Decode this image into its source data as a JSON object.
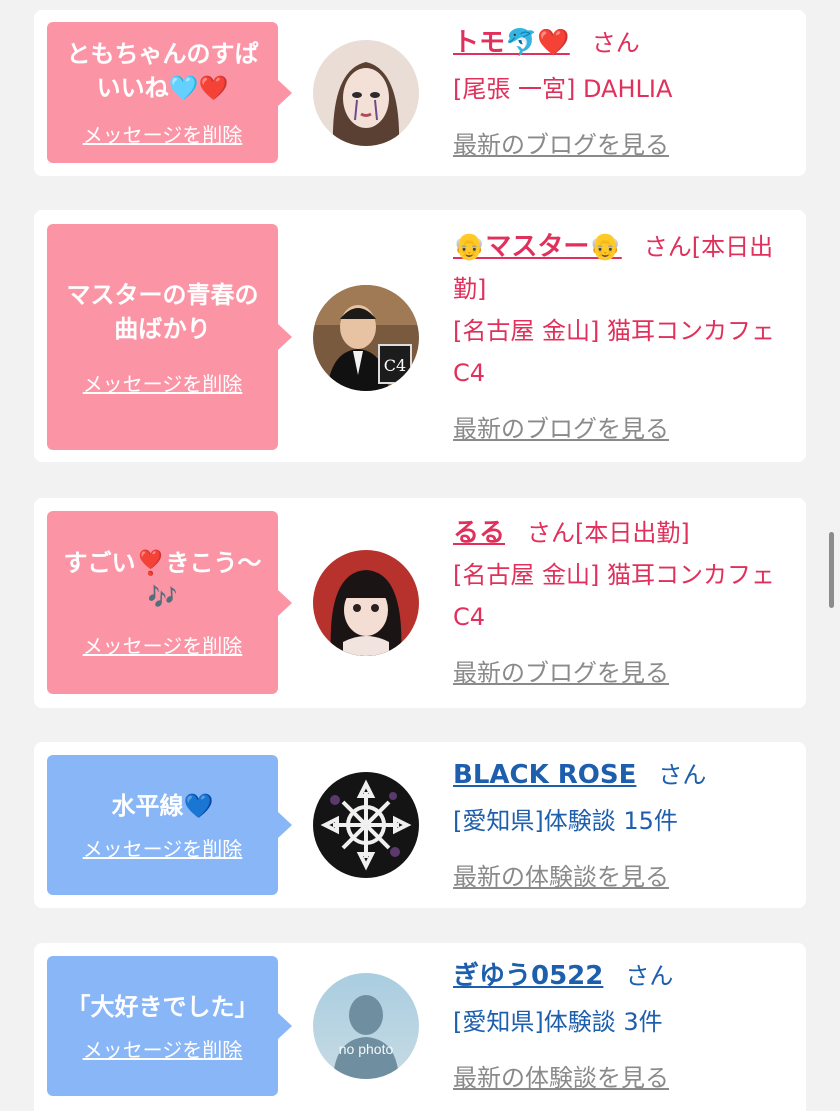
{
  "items": [
    {
      "message": "ともちゃんのすぱいいね🩵❤️",
      "delete_label": "メッセージを削除",
      "name": "トモ🐬❤️",
      "honorific": "さん",
      "status": "",
      "shop": "[尾張 一宮] DAHLIA",
      "link": "最新のブログを見る",
      "avatar_icon": "avatar-photo-icon"
    },
    {
      "message": "マスターの青春の曲ばかり",
      "delete_label": "メッセージを削除",
      "name": "👴マスター👴",
      "honorific": "さん",
      "status": "[本日出勤]",
      "shop": "[名古屋 金山] 猫耳コンカフェ C4",
      "link": "最新のブログを見る",
      "avatar_icon": "avatar-photo-icon"
    },
    {
      "message": "すごい❣️きこう〜🎶",
      "delete_label": "メッセージを削除",
      "name": "るる",
      "honorific": "さん",
      "status": "[本日出勤]",
      "shop": "[名古屋 金山] 猫耳コンカフェ C4",
      "link": "最新のブログを見る",
      "avatar_icon": "avatar-photo-icon"
    },
    {
      "message": "水平線💙",
      "delete_label": "メッセージを削除",
      "name": "BLACK ROSE",
      "honorific": "さん",
      "status": "",
      "shop": "[愛知県]体験談 15件",
      "link": "最新の体験談を見る",
      "avatar_icon": "avatar-pattern-icon"
    },
    {
      "message": "「大好きでした」",
      "delete_label": "メッセージを削除",
      "name": "ぎゆう0522",
      "honorific": "さん",
      "status": "",
      "shop": "[愛知県]体験談 3件",
      "link": "最新の体験談を見る",
      "avatar_icon": "no-photo-icon",
      "avatar_text": "no photo"
    }
  ],
  "colors": {
    "pink_bubble": "#fb95a6",
    "blue_bubble": "#88b6f6",
    "pink_text": "#e0305b",
    "blue_text": "#1e5fad",
    "link_gray": "#8a8a8a"
  }
}
